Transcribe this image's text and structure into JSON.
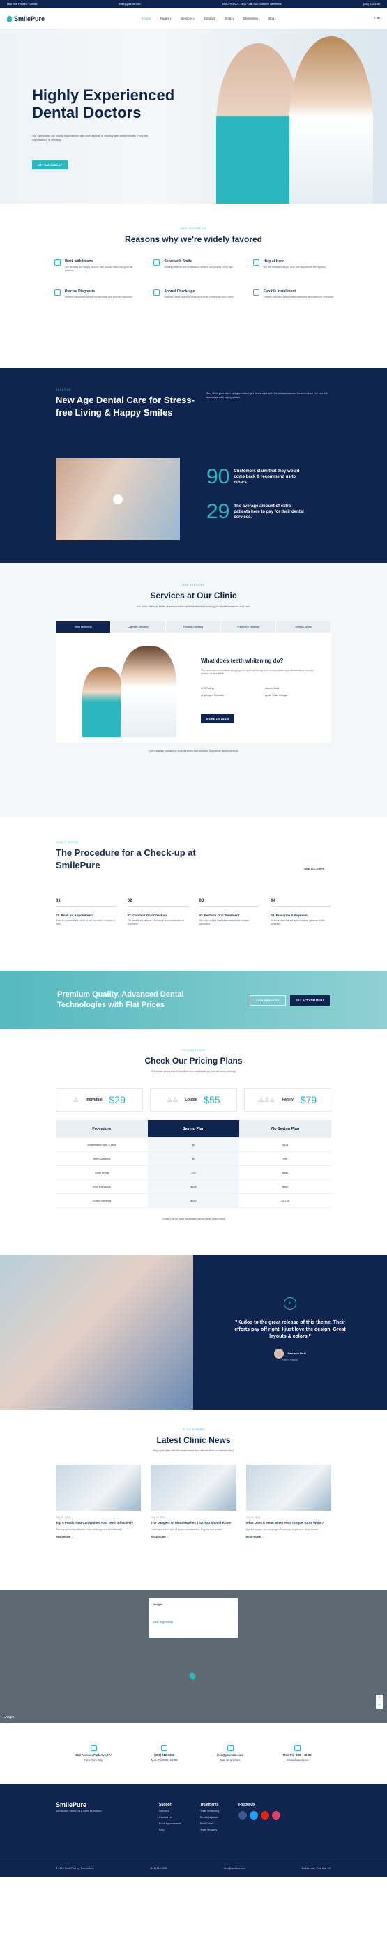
{
  "brand": {
    "name": "SmilePure"
  },
  "nav": [
    "Home",
    "Pages",
    "Services",
    "Contact",
    "Shop",
    "Elements",
    "Blog"
  ],
  "topbar": {
    "left": "New York Pediatric · Dentist",
    "email": "hello@yoursite.com",
    "hours": "Mon–Fri: 8:00 – 18:00 · Sat–Sun: Closed in Weekends",
    "phone": "(000) 812-3456"
  },
  "hero": {
    "title": "Highly Experienced Dental Doctors",
    "text": "Our specialists are highly experienced and professional in dealing with dental health. They are experienced in dentistry.",
    "cta": "GET A CHECKUP"
  },
  "favored": {
    "sub": "WHY CHOOSE US",
    "title": "Reasons why we're widely favored",
    "items": [
      {
        "t": "Work with Hearts",
        "d": "Our dentists are happy to work with passion and caring for all patients."
      },
      {
        "t": "Serve with Smile",
        "d": "Serving patients with a pleasant smile is our priority every day."
      },
      {
        "t": "Help at Hand",
        "d": "We are always ready to help with any dental emergency."
      },
      {
        "t": "Precise Diagnosis",
        "d": "Modern equipment allows for accurate and precise diagnosis."
      },
      {
        "t": "Annual Check-ups",
        "d": "Regular check-ups help keep your smile healthy all year round."
      },
      {
        "t": "Flexible Installment",
        "d": "Flexible payment plans make treatment affordable for everyone."
      }
    ]
  },
  "care": {
    "sub": "ABOUT US",
    "title": "New Age Dental Care for Stress-free Living & Happy Smiles",
    "text": "Over 30 of your teeth and gum tissue get dental care with the most advanced treatments so you can live stress-free with happy smiles.",
    "stats": [
      {
        "n": "90",
        "d": "Customers claim that they would come back & recommend us to others."
      },
      {
        "n": "29",
        "d": "The average amount of extra patients here to pay for their dental services."
      }
    ]
  },
  "services": {
    "sub": "OUR SERVICES",
    "title": "Services at Our Clinic",
    "lead": "Our clinic offers all kinds of services and uses the latest technology for dental treatment and care.",
    "tabs": [
      "Teeth Whitening",
      "Cosmetic Dentistry",
      "Pediatric Dentistry",
      "Preventive Dentistry",
      "Dental Crowns"
    ],
    "panel_title": "What does teeth whitening do?",
    "panel_text": "The most common reason people go for teeth whitening is to remove stains and discoloration from the surface of their teeth.",
    "bullets": [
      "Oil Pulling",
      "Hydrogen Peroxide",
      "Lemon Juice",
      "Apple Cider Vinegar"
    ],
    "panel_btn": "MORE DETAILS",
    "note": "Don't hesitate, contact us for better help and services. Explore all dental services"
  },
  "proc": {
    "sub": "HOW IT WORKS",
    "title": "The Procedure for a Check-up at SmilePure",
    "more": "VIEW ALL STEPS",
    "steps": [
      {
        "n": "01",
        "t": "01. Book an Appointment",
        "d": "Book an appointment online or call our clinic to choose a time."
      },
      {
        "n": "02",
        "t": "02. Conduct Oral Checkup",
        "d": "Our dentist will perform a thorough oral examination of your teeth."
      },
      {
        "n": "03",
        "t": "03. Perform Oral Treatment",
        "d": "We carry out the treatment needed with modern equipment."
      },
      {
        "n": "04",
        "t": "04. Prescribe & Payment",
        "d": "Receive prescriptions and complete payment at the reception."
      }
    ]
  },
  "banner": {
    "title": "Premium Quality, Advanced Dental Technologies with Flat Prices",
    "b1": "VIEW SERVICES",
    "b2": "GET APPOINTMENT"
  },
  "pricing": {
    "sub": "PRICING PLANS",
    "title": "Check Our Pricing Plans",
    "lead": "We create plans that fit families and individuals so you can keep smiling.",
    "cards": [
      {
        "t": "Individual",
        "p": "$29"
      },
      {
        "t": "Couple",
        "p": "$55"
      },
      {
        "t": "Family",
        "p": "$79"
      }
    ],
    "cols": [
      "Procedure",
      "Saving Plan",
      "No Saving Plan"
    ],
    "rows": [
      [
        "Examination with X-rays",
        "$0",
        "$118"
      ],
      [
        "Teeth Cleaning",
        "$0",
        "$95"
      ],
      [
        "Tooth Filling",
        "$76",
        "$185"
      ],
      [
        "Root Extraction",
        "$325",
        "$800"
      ],
      [
        "Crown Inserting",
        "$530",
        "$1,150"
      ]
    ],
    "note": "Contact us for more information about plans. Learn more"
  },
  "testimonial": {
    "quote": "\"Kudos to the great release of this theme. Their efforts pay off right. I just love the design. Great layouts & colors.\"",
    "name": "Harrison Noel",
    "role": "Happy Patient"
  },
  "news": {
    "sub": "BLOG & NEWS",
    "title": "Latest Clinic News",
    "lead": "Stay up to date with the latest news and articles from our dental clinic.",
    "posts": [
      {
        "date": "July 14, 2024",
        "t": "Top 5 Foods That Can Whiten Your Teeth Effectively",
        "d": "Discover the foods that can help whiten your teeth naturally.",
        "rm": "READ MORE →"
      },
      {
        "date": "July 14, 2024",
        "t": "The Dangers Of Mouthwashes That You Should Know",
        "d": "Learn about the risks of some mouthwashes for your oral health.",
        "rm": "READ MORE →"
      },
      {
        "date": "July 14, 2024",
        "t": "What Does It Mean When Your Tongue Turns White?",
        "d": "A white tongue can be a sign of poor oral hygiene or other issues.",
        "rm": "READ MORE →"
      }
    ]
  },
  "map": {
    "label": "Google",
    "card_title": "Google",
    "card_text": "View larger map"
  },
  "contact": [
    {
      "t": "2nd Avenue, Park Ave, NY",
      "s": "New York City"
    },
    {
      "t": "(000) 812-3456",
      "s": "Mon–Fri 8:00–18:00"
    },
    {
      "t": "info@yoursite.com",
      "s": "Mail us anytime"
    },
    {
      "t": "Mon-Fri: 8:00 - 18:00",
      "s": "Closed weekend"
    }
  ],
  "footer": {
    "about": "50 Second Street, FLA Sans Francisco",
    "support_title": "Support",
    "support": [
      "Services",
      "Contact Us",
      "Book Appointment",
      "FAQ"
    ],
    "links_title": "Treatments",
    "links": [
      "Teeth Whitening",
      "Dental Implants",
      "Root Canal",
      "Teeth Veneers"
    ],
    "follow_title": "Follow Us",
    "copy": "© 2024 SmilePure by ThemeMove",
    "phone": "(000) 812-3456",
    "email": "hello@yoursite.com",
    "addr": "2nd Avenue, Park Ave, NY"
  }
}
